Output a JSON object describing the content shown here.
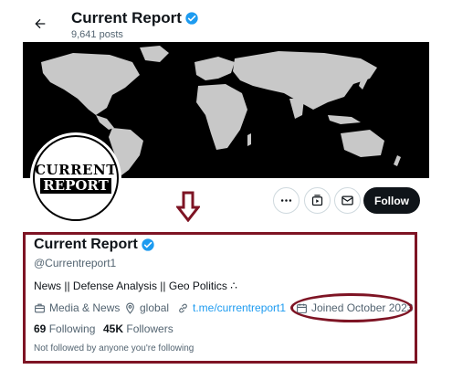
{
  "header": {
    "title": "Current Report",
    "post_count": "9,641 posts",
    "back_icon": "arrow-left-icon"
  },
  "avatar": {
    "line1": "CURRENT",
    "line2": "REPORT"
  },
  "actions": {
    "more_icon": "more-icon",
    "subscribe_icon": "subscribe-icon",
    "message_icon": "envelope-icon",
    "follow_label": "Follow"
  },
  "profile": {
    "name": "Current Report",
    "handle": "@Currentreport1",
    "bio": "News || Defense Analysis || Geo Politics ∴",
    "category": "Media & News",
    "location": "global",
    "link": "t.me/currentreport1",
    "joined": "Joined October 2023",
    "following_count": "69",
    "following_label": "Following",
    "followers_count": "45K",
    "followers_label": "Followers",
    "not_followed": "Not followed by anyone you're following"
  },
  "colors": {
    "verified": "#1d9bf0",
    "annotation": "#7e1424",
    "link": "#1d9bf0",
    "follow_button": "#0f1419"
  }
}
